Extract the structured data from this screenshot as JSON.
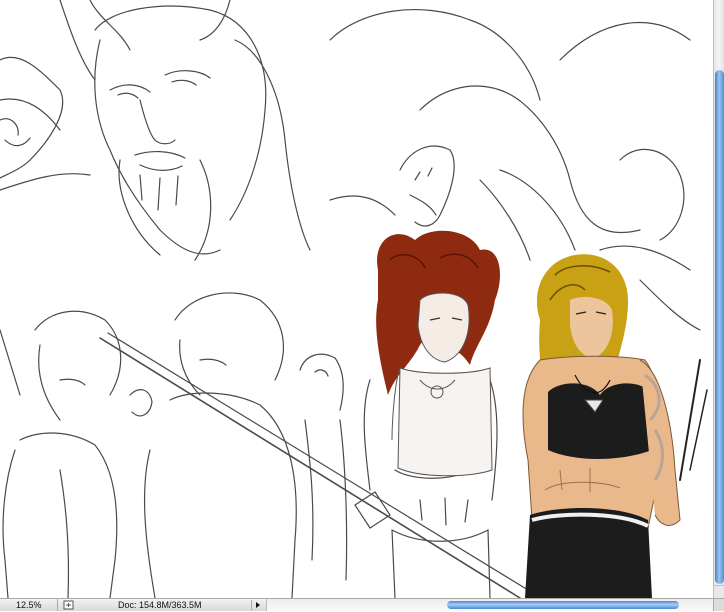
{
  "status_bar": {
    "zoom_level": "12.5%",
    "document_info": "Doc: 154.8M/363.5M"
  },
  "icons": {
    "status_menu": "document-status-icon",
    "info_arrow": "triangle-right-icon"
  },
  "scrollbars": {
    "vertical_position": 0.12,
    "horizontal_position": 0.4
  },
  "colors": {
    "scroll_thumb": "#4a88d6",
    "red_hair": "#8e2a10",
    "blond_hair": "#c9a114",
    "skin": "#e9b98c",
    "top_black": "#1c1c1c"
  }
}
